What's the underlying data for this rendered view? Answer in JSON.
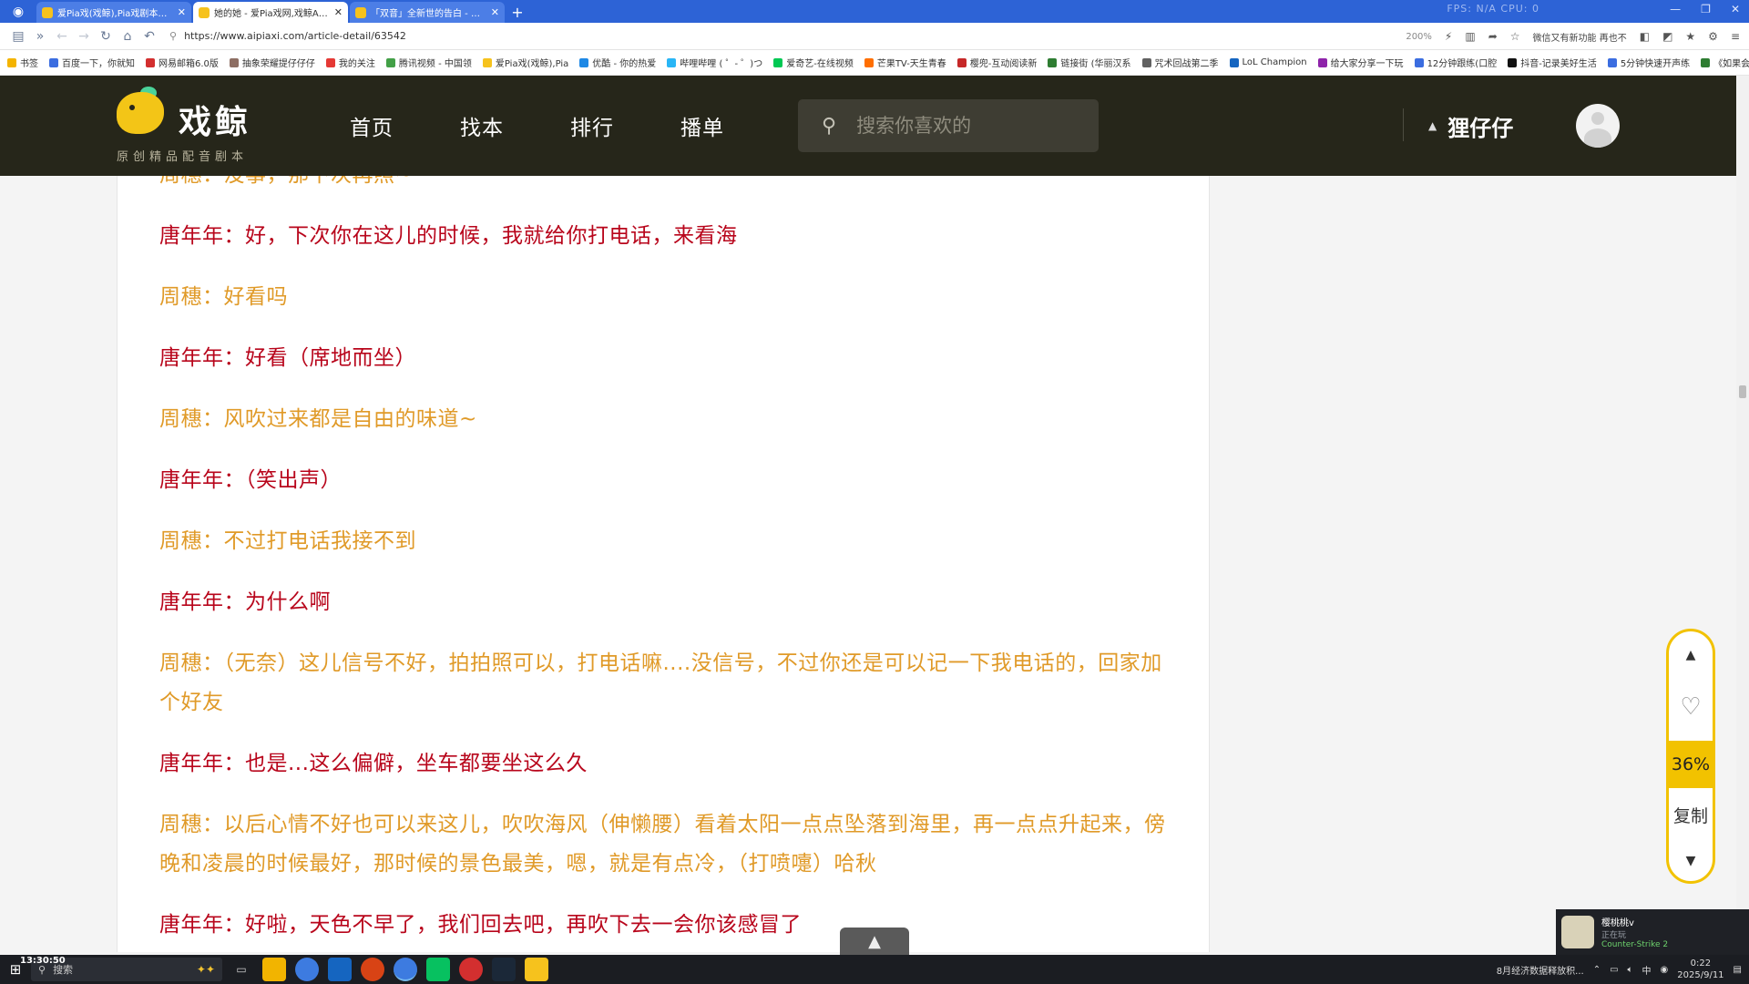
{
  "browser": {
    "tabs": [
      {
        "title": "爱Pia戏(戏鲸),Pia戏剧本网,广播",
        "active": false
      },
      {
        "title": "她的她 - 爱Pia戏网,戏鲸App,Pi",
        "active": true
      },
      {
        "title": "「双音」全新世的告白 - 爱Pia",
        "active": false
      }
    ],
    "new_tab": "+",
    "fps_label": "FPS: N/A    CPU: 0",
    "url": "https://www.aipiaxi.com/article-detail/63542",
    "zoom": "200%",
    "news_ticker": "微信又有新功能 再也不",
    "bookmarks": [
      "书签",
      "百度一下，你就知",
      "网易邮箱6.0版",
      "抽象荣耀提仔仔仔",
      "我的关注",
      "腾讯视频 - 中国领",
      "爱Pia戏(戏鲸),Pia",
      "优酷 - 你的热爱",
      "哔哩哔哩 ( ゜- ゜)つ",
      "爱奇艺-在线视频",
      "芒果TV-天生青春",
      "樱兜-互动阅读新",
      "链接街 (华丽汉系",
      "咒术回战第二季",
      "LoL Champion",
      "给大家分享一下玩",
      "12分钟跟练(口腔",
      "抖音-记录美好生活",
      "5分钟快速开声练",
      "《如果会命独轮》"
    ]
  },
  "site": {
    "logo_name": "戏鲸",
    "logo_slogan": "原创精品配音剧本",
    "nav": [
      "首页",
      "找本",
      "排行",
      "播单"
    ],
    "search_placeholder": "搜索你喜欢的",
    "username": "狸仔仔"
  },
  "script_lines": [
    {
      "speaker": "zhou",
      "text": "周穗：没事，那下次再照~"
    },
    {
      "speaker": "tang",
      "text": "唐年年：好，下次你在这儿的时候，我就给你打电话，来看海"
    },
    {
      "speaker": "zhou",
      "text": "周穗：好看吗"
    },
    {
      "speaker": "tang",
      "text": "唐年年：好看（席地而坐）"
    },
    {
      "speaker": "zhou",
      "text": "周穗：风吹过来都是自由的味道~"
    },
    {
      "speaker": "tang",
      "text": "唐年年：（笑出声）"
    },
    {
      "speaker": "zhou",
      "text": "周穗：不过打电话我接不到"
    },
    {
      "speaker": "tang",
      "text": "唐年年：为什么啊"
    },
    {
      "speaker": "zhou",
      "text": "周穗：（无奈）这儿信号不好，拍拍照可以，打电话嘛....没信号，不过你还是可以记一下我电话的，回家加个好友"
    },
    {
      "speaker": "tang",
      "text": "唐年年：也是...这么偏僻，坐车都要坐这么久"
    },
    {
      "speaker": "zhou",
      "text": "周穗：以后心情不好也可以来这儿，吹吹海风（伸懒腰）看着太阳一点点坠落到海里，再一点点升起来，傍晚和凌晨的时候最好，那时候的景色最美，嗯，就是有点冷，（打喷嚏）哈秋"
    },
    {
      "speaker": "tang",
      "text": "唐年年：好啦，天色不早了，我们回去吧，再吹下去一会你该感冒了"
    }
  ],
  "float_toolbar": {
    "up": "▲",
    "like": "♡",
    "progress": "36%",
    "copy": "复制",
    "down": "▼"
  },
  "colors": {
    "header_bg": "#26261a",
    "tang_color": "#b8051b",
    "zhou_color": "#e09a28",
    "accent_yellow": "#f2c200"
  },
  "notification": {
    "name": "樱桃桃v",
    "status": "正在玩",
    "game": "Counter-Strike 2"
  },
  "taskbar": {
    "search_label": "搜索",
    "news": "8月经济数据释放积...",
    "ime": "中",
    "time": "0:22",
    "date": "2025/9/11",
    "overlay_clock": "13:30:50"
  }
}
